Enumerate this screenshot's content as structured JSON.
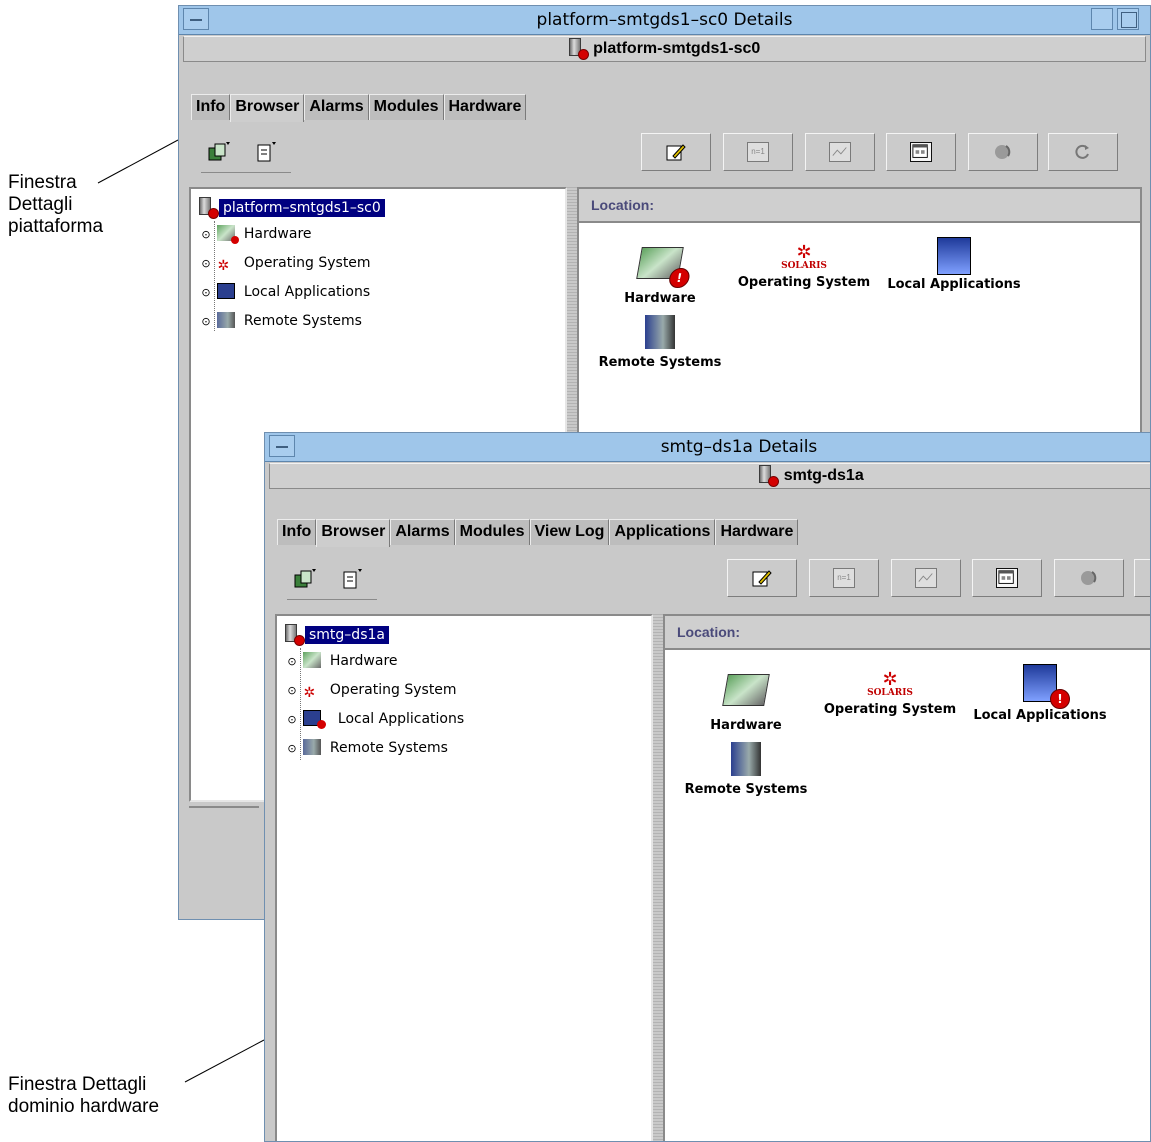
{
  "callouts": {
    "platform": [
      "Finestra",
      "Dettagli",
      "piattaforma"
    ],
    "domain": [
      "Finestra Dettagli",
      "dominio hardware"
    ]
  },
  "window1": {
    "title": "platform–smtgds1–sc0 Details",
    "host": "platform-smtgds1-sc0",
    "tabs": [
      "Info",
      "Browser",
      "Alarms",
      "Modules",
      "Hardware"
    ],
    "active_tab": "Browser",
    "tree_root": "platform–smtgds1–sc0",
    "tree_nodes": [
      "Hardware",
      "Operating System",
      "Local Applications",
      "Remote Systems"
    ],
    "location_label": "Location:",
    "icons": [
      "Hardware",
      "Operating System",
      "Local Applications",
      "Remote Systems"
    ],
    "solaris": "SOLARIS"
  },
  "window2": {
    "title": "smtg–ds1a Details",
    "host": "smtg-ds1a",
    "tabs": [
      "Info",
      "Browser",
      "Alarms",
      "Modules",
      "View Log",
      "Applications",
      "Hardware"
    ],
    "active_tab": "Browser",
    "tree_root": "smtg–ds1a",
    "tree_nodes": [
      "Hardware",
      "Operating System",
      "Local Applications",
      "Remote Systems"
    ],
    "location_label": "Location:",
    "icons": [
      "Hardware",
      "Operating System",
      "Local Applications",
      "Remote Systems"
    ],
    "solaris": "SOLARIS"
  },
  "toolbar": {
    "btn2_glyph": "n=1",
    "icon_names": [
      "edit-icon",
      "n-equals-1-icon",
      "graph-icon",
      "window-icon",
      "refresh-gear-icon",
      "reload-icon"
    ]
  },
  "colors": {
    "titlebar": "#9fc6ea",
    "selection": "#000080",
    "alarm": "#d40000",
    "chrome": "#c9c9c9"
  }
}
